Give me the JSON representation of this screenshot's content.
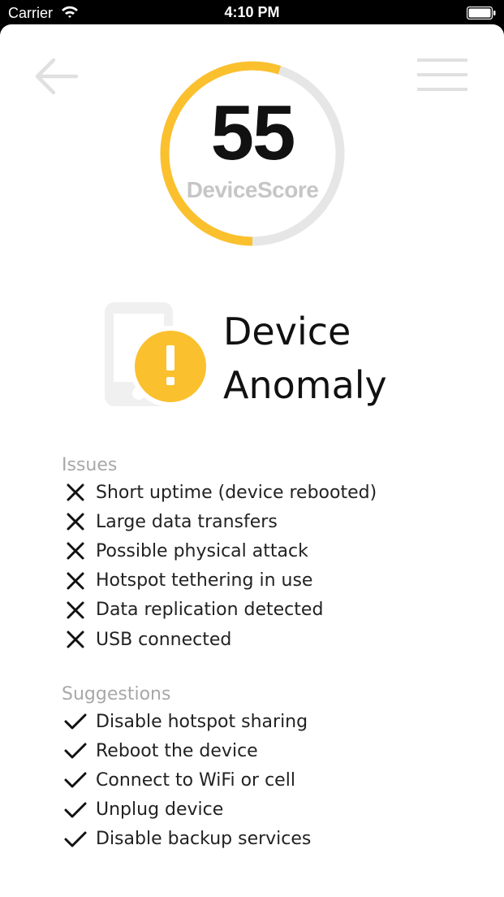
{
  "status_bar": {
    "carrier": "Carrier",
    "time": "4:10 PM"
  },
  "nav": {
    "back_icon": "arrow-left-icon",
    "menu_icon": "hamburger-menu-icon"
  },
  "score": {
    "value": "55",
    "label": "DeviceScore",
    "percent": 55,
    "color_fill": "#FBC02D",
    "color_track": "#E6E6E6"
  },
  "status": {
    "title_line1": "Device",
    "title_line2": "Anomaly",
    "icon": "device-warning-icon",
    "badge_color": "#FBC02D"
  },
  "issues": {
    "header": "Issues",
    "items": [
      "Short uptime (device rebooted)",
      "Large data transfers",
      "Possible physical attack",
      "Hotspot tethering in use",
      "Data replication detected",
      "USB connected"
    ]
  },
  "suggestions": {
    "header": "Suggestions",
    "items": [
      "Disable hotspot sharing",
      "Reboot the device",
      "Connect to WiFi or cell",
      "Unplug device",
      "Disable backup services"
    ]
  }
}
